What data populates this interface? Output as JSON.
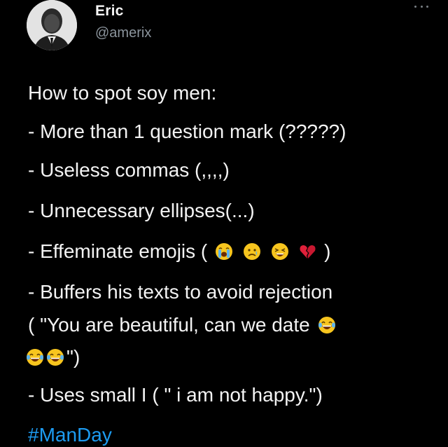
{
  "author": {
    "display_name": "Eric",
    "handle": "@amerix"
  },
  "tweet": {
    "heading": "How to spot soy men:",
    "line1": "- More than 1 question mark (?????)",
    "line2": "- Useless commas (,,,,)",
    "line3": "- Unnecessary ellipses(...)",
    "line4_prefix": "- Effeminate emojis (",
    "line4_suffix": ")",
    "line5": "- Buffers his texts to avoid rejection",
    "line6_prefix": "( \"You are beautiful, can we date",
    "line7_suffix": "\")",
    "line8": "- Uses small I ( \" i am not happy.\")",
    "hashtag": "#ManDay"
  },
  "emojis": {
    "line4": [
      "loudly-crying-face",
      "sad-but-relieved-face",
      "tired-face",
      "broken-heart"
    ],
    "line6": [
      "face-with-tears-of-joy"
    ],
    "line7": [
      "face-with-tears-of-joy",
      "face-with-tears-of-joy"
    ]
  },
  "colors": {
    "background": "#000000",
    "text": "#f3f3f3",
    "handle": "#8b949c",
    "hashtag": "#1d9bf0"
  }
}
